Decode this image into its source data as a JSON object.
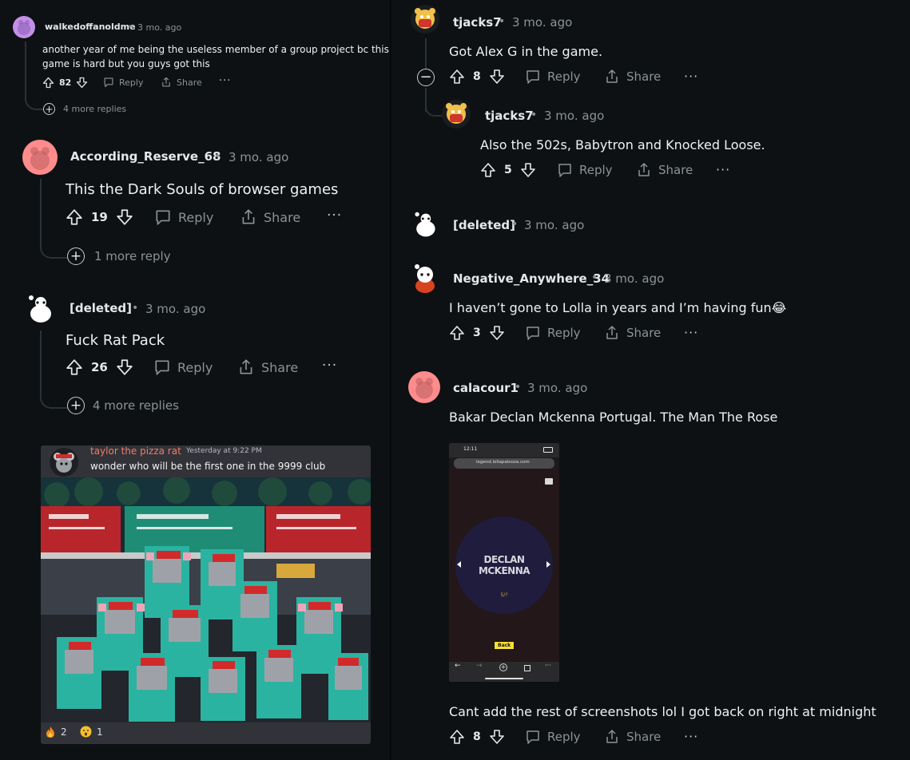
{
  "left": {
    "c1": {
      "username": "walkedoffanoldme",
      "sep": "•",
      "time": "3 mo. ago",
      "text_line1": "another year of me being the useless member of a group project bc this",
      "text_line2": "game is hard but you guys got this",
      "votes": "82",
      "reply": "Reply",
      "share": "Share",
      "more_replies": "4 more replies"
    },
    "c2": {
      "username": "According_Reserve_68",
      "sep": "•",
      "time": "3 mo. ago",
      "text": "This the Dark Souls of browser games",
      "votes": "19",
      "reply": "Reply",
      "share": "Share",
      "more_replies": "1 more reply"
    },
    "c3": {
      "username": "[deleted]",
      "sep": "•",
      "time": "3 mo. ago",
      "text": "Fuck Rat Pack",
      "votes": "26",
      "reply": "Reply",
      "share": "Share",
      "more_replies": "4 more replies"
    },
    "discord": {
      "author": "taylor the pizza rat",
      "time": "Yesterday at 9:22 PM",
      "message": "wonder who will be the first one in the 9999 club",
      "reaction1_count": "2",
      "reaction2_count": "1",
      "accent_color": "#f47b67"
    }
  },
  "right": {
    "c1": {
      "username": "tjacks7",
      "sep": "•",
      "time": "3 mo. ago",
      "text": "Got Alex G in the game.",
      "votes": "8",
      "reply": "Reply",
      "share": "Share"
    },
    "c1r": {
      "username": "tjacks7",
      "sep": "•",
      "time": "3 mo. ago",
      "text": "Also the 502s, Babytron and Knocked Loose.",
      "votes": "5",
      "reply": "Reply",
      "share": "Share"
    },
    "c2": {
      "username": "[deleted]",
      "sep": "•",
      "time": "3 mo. ago"
    },
    "c3": {
      "username": "Negative_Anywhere_34",
      "sep": "•",
      "time": "3 mo. ago",
      "text": "I haven’t gone to Lolla in years and I’m having fun",
      "emoji": "😂",
      "votes": "3",
      "reply": "Reply",
      "share": "Share"
    },
    "c4": {
      "username": "calacour1",
      "sep": "•",
      "time": "3 mo. ago",
      "text": "Bakar Declan Mckenna Portugal. The Man The Rose",
      "phone": {
        "clock": "12:11",
        "url": "legend.lollapalooza.com",
        "artist_line1": "DECLAN",
        "artist_line2": "MCKENNA",
        "counter": "5/?",
        "back": "Back"
      },
      "text2": "Cant add the rest of screenshots lol I got back on right at midnight",
      "votes": "8",
      "reply": "Reply",
      "share": "Share"
    }
  }
}
